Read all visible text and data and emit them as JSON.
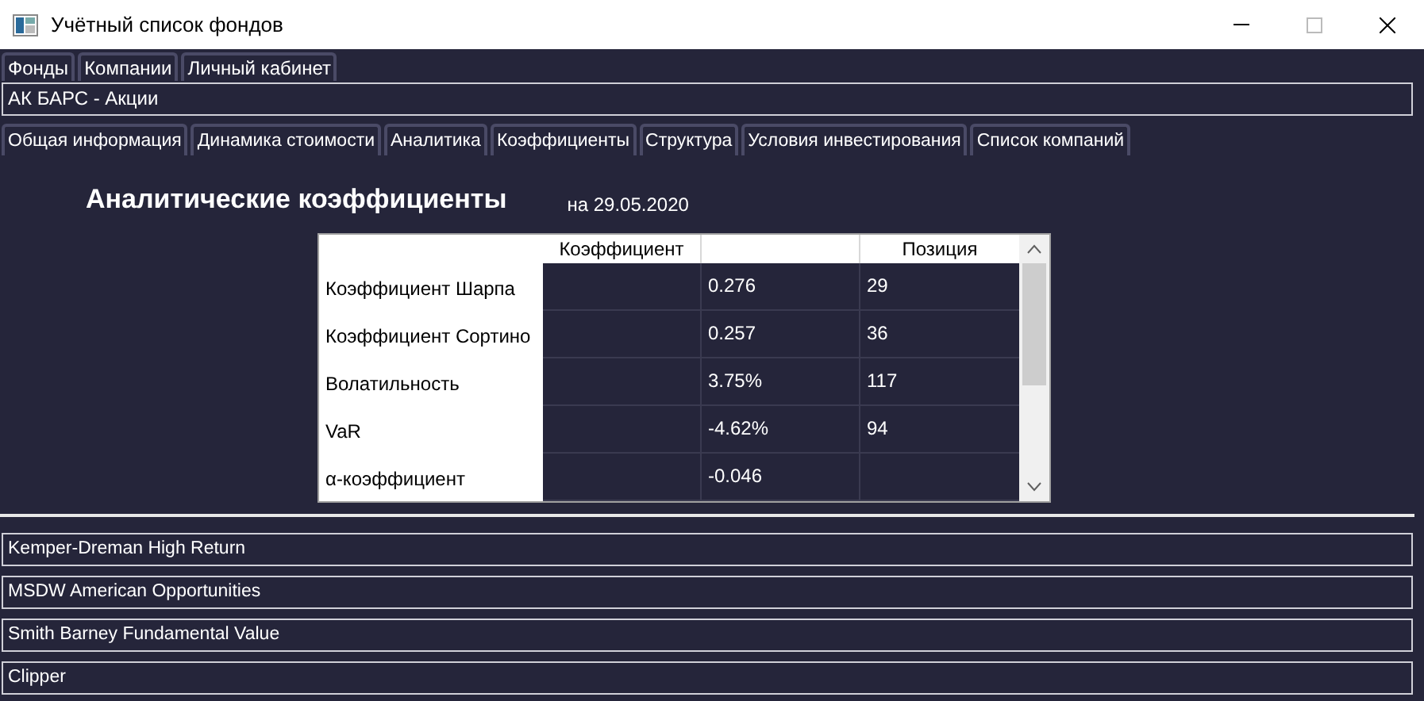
{
  "window": {
    "title": "Учётный список фондов"
  },
  "main_tabs": [
    {
      "label": "Фонды"
    },
    {
      "label": "Компании"
    },
    {
      "label": "Личный кабинет"
    }
  ],
  "fund": "АК БАРС - Акции",
  "section_tabs": [
    {
      "label": "Общая информация"
    },
    {
      "label": "Динамика стоимости"
    },
    {
      "label": "Аналитика"
    },
    {
      "label": "Коэффициенты"
    },
    {
      "label": "Структура"
    },
    {
      "label": "Условия инвестирования"
    },
    {
      "label": "Список компаний"
    }
  ],
  "heading": "Аналитические коэффициенты",
  "date": "на 29.05.2020",
  "table": {
    "header": {
      "column_1": "Коэффициент",
      "column_3": "Позиция"
    },
    "rows": [
      {
        "name": "Коэффициент Шарпа",
        "column_2": "0.276",
        "column_3": "29"
      },
      {
        "name": "Коэффициент Сортино",
        "column_2": "0.257",
        "column_3": "36"
      },
      {
        "name": "Волатильность",
        "column_2": "3.75%",
        "column_3": "117"
      },
      {
        "name": "VaR",
        "column_2": "-4.62%",
        "column_3": "94"
      },
      {
        "name": "α-коэффициент",
        "column_2": "-0.046"
      }
    ]
  },
  "fund_list": [
    "Kemper-Dreman High Return",
    "MSDW American Opportunities",
    "Smith Barney Fundamental Value",
    "Clipper"
  ]
}
